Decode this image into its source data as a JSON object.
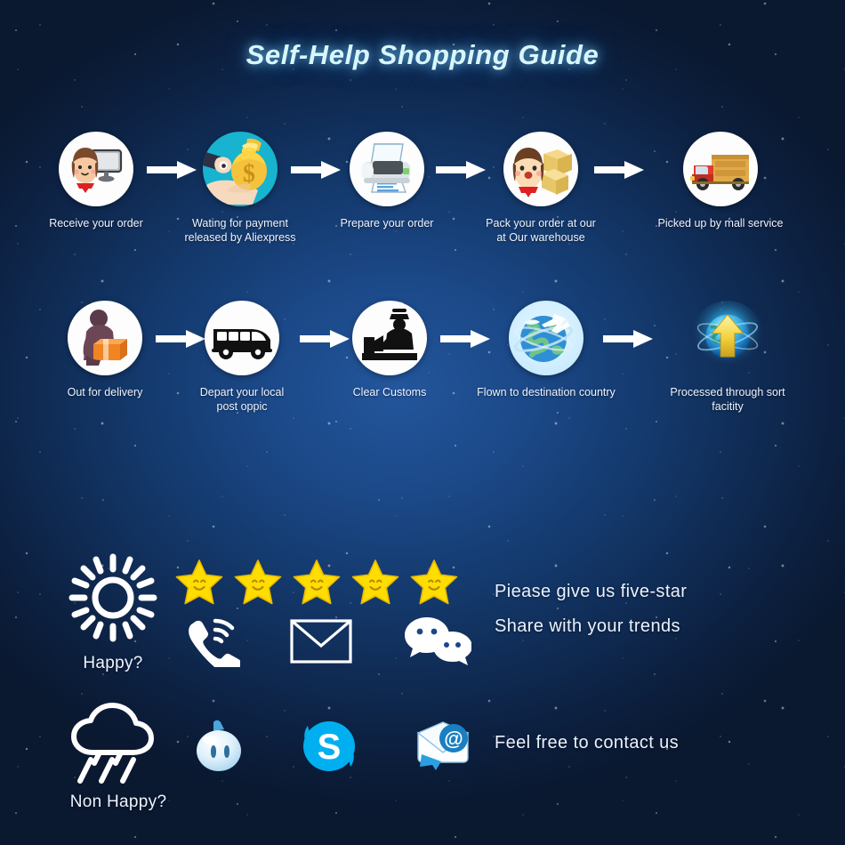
{
  "title": "Self-Help Shopping Guide",
  "colors": {
    "background_dark": "#0a1830",
    "background_mid": "#1b4887",
    "background_light": "#23569c",
    "title_text": "#d9f6ff",
    "body_text": "#eef4ff",
    "star_yellow": "#ffdd00",
    "accent_teal": "#17b3cf",
    "arrow_white": "#ffffff",
    "skype_blue": "#00aff0"
  },
  "flow": {
    "row1": [
      {
        "icon": "girl-computer-icon",
        "label": "Receive your order"
      },
      {
        "icon": "hand-money-bag-icon",
        "label": "Wating for payment\nreleased by Aliexpress"
      },
      {
        "icon": "printer-icon",
        "label": "Prepare your order"
      },
      {
        "icon": "girl-packages-icon",
        "label": "Pack your order at our\nat Our warehouse"
      },
      {
        "icon": "delivery-truck-icon",
        "label": "Picked up by mall service"
      }
    ],
    "row2": [
      {
        "icon": "courier-parcel-icon",
        "label": "Out for delivery"
      },
      {
        "icon": "delivery-van-icon",
        "label": "Depart your local\npost oppic"
      },
      {
        "icon": "customs-officer-icon",
        "label": "Clear Customs"
      },
      {
        "icon": "globe-airplane-icon",
        "label": "Flown to destination country"
      },
      {
        "icon": "globe-arrow-up-icon",
        "label": "Processed through sort facitity"
      }
    ],
    "arrow_icon": "right-arrow-icon"
  },
  "feedback": {
    "happy": {
      "icon": "sun-icon",
      "label": "Happy?",
      "rating_icon": "yellow-smiling-star-icon",
      "rating_count": 5,
      "messages": [
        "Piease give us five-star",
        "Share with your trends"
      ],
      "contacts": [
        {
          "icon": "ringing-phone-icon",
          "name": "phone"
        },
        {
          "icon": "envelope-icon",
          "name": "email"
        },
        {
          "icon": "wechat-bubbles-icon",
          "name": "wechat"
        }
      ]
    },
    "non_happy": {
      "icon": "rain-cloud-icon",
      "label": "Non Happy?",
      "message": "Feel free to contact us",
      "contacts": [
        {
          "icon": "tradmanager-icon",
          "name": "trade-manager"
        },
        {
          "icon": "skype-icon",
          "name": "skype",
          "glyph": "S"
        },
        {
          "icon": "email-at-icon",
          "name": "email"
        }
      ]
    }
  }
}
